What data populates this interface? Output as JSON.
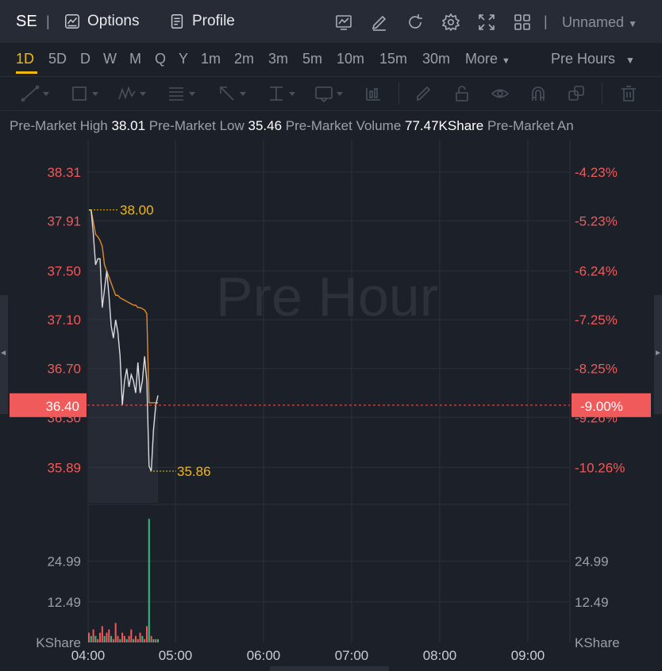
{
  "header": {
    "ticker": "SE",
    "separator": "|",
    "options_label": "Options",
    "profile_label": "Profile",
    "layout_name": "Unnamed"
  },
  "periods": {
    "items": [
      "1D",
      "5D",
      "D",
      "W",
      "M",
      "Q",
      "Y",
      "1m",
      "2m",
      "3m",
      "5m",
      "10m",
      "15m",
      "30m",
      "More"
    ],
    "active": "1D",
    "session": "Pre Hours"
  },
  "info": {
    "high_label": "Pre-Market High",
    "high_value": "38.01",
    "low_label": "Pre-Market Low",
    "low_value": "35.46",
    "volume_label": "Pre-Market Volume",
    "volume_value": "77.47KShare",
    "amount_label": "Pre-Market An"
  },
  "colors": {
    "background": "#1c2029",
    "toolbar": "#262b36",
    "accent": "#f0b90b",
    "down": "#f05a5a",
    "up": "#2ebd85",
    "price_line": "#d9dbe0",
    "avg_line": "#e08a2c"
  },
  "chart_data": {
    "type": "line",
    "watermark": "Pre Hour",
    "x_labels": [
      "04:00",
      "05:00",
      "06:00",
      "07:00",
      "08:00",
      "09:00"
    ],
    "price_axis_left": [
      "38.31",
      "37.91",
      "37.50",
      "37.10",
      "36.70",
      "36.30",
      "35.89"
    ],
    "price_axis_right": [
      "-4.23%",
      "-5.23%",
      "-6.24%",
      "-7.25%",
      "-8.25%",
      "-9.26%",
      "-10.26%"
    ],
    "current_price": "36.40",
    "current_change": "-9.00%",
    "high_marker": "38.00",
    "low_marker": "35.86",
    "ylim": [
      35.6,
      38.55
    ],
    "series": [
      {
        "values": [
          38.0,
          38.0,
          37.8,
          37.55,
          37.6,
          37.6,
          37.2,
          37.35,
          37.5,
          37.3,
          37.05,
          36.95,
          37.1,
          37.0,
          36.8,
          36.4,
          36.6,
          36.7,
          36.55,
          36.65,
          36.6,
          36.5,
          36.75,
          36.5,
          36.6,
          36.8,
          36.6,
          35.9,
          35.86,
          36.2,
          36.4,
          36.48
        ]
      },
      {
        "values": [
          38.0,
          38.0,
          37.9,
          37.8,
          37.78,
          37.75,
          37.7,
          37.55,
          37.5,
          37.45,
          37.4,
          37.35,
          37.3,
          37.3,
          37.28,
          37.27,
          37.26,
          37.25,
          37.24,
          37.23,
          37.22,
          37.22,
          37.2,
          37.2,
          37.19,
          37.18,
          37.15,
          36.42,
          36.42,
          36.42,
          36.42,
          36.42
        ]
      }
    ],
    "volume_axis": [
      "24.99",
      "12.49"
    ],
    "volume_unit": "KShare",
    "volume_ylim": [
      0,
      40
    ],
    "volume": [
      3,
      2,
      4,
      2,
      1,
      3,
      5,
      2,
      3,
      4,
      2,
      1,
      6,
      2,
      1,
      3,
      2,
      1,
      2,
      4,
      1,
      2,
      1,
      3,
      2,
      1,
      5,
      38,
      2,
      1,
      1,
      1
    ],
    "volume_up": [
      false,
      true,
      false,
      true,
      false,
      false,
      false,
      true,
      false,
      false,
      true,
      false,
      false,
      false,
      true,
      false,
      false,
      true,
      false,
      false,
      true,
      false,
      false,
      false,
      true,
      false,
      false,
      true,
      false,
      true,
      false,
      true
    ]
  }
}
